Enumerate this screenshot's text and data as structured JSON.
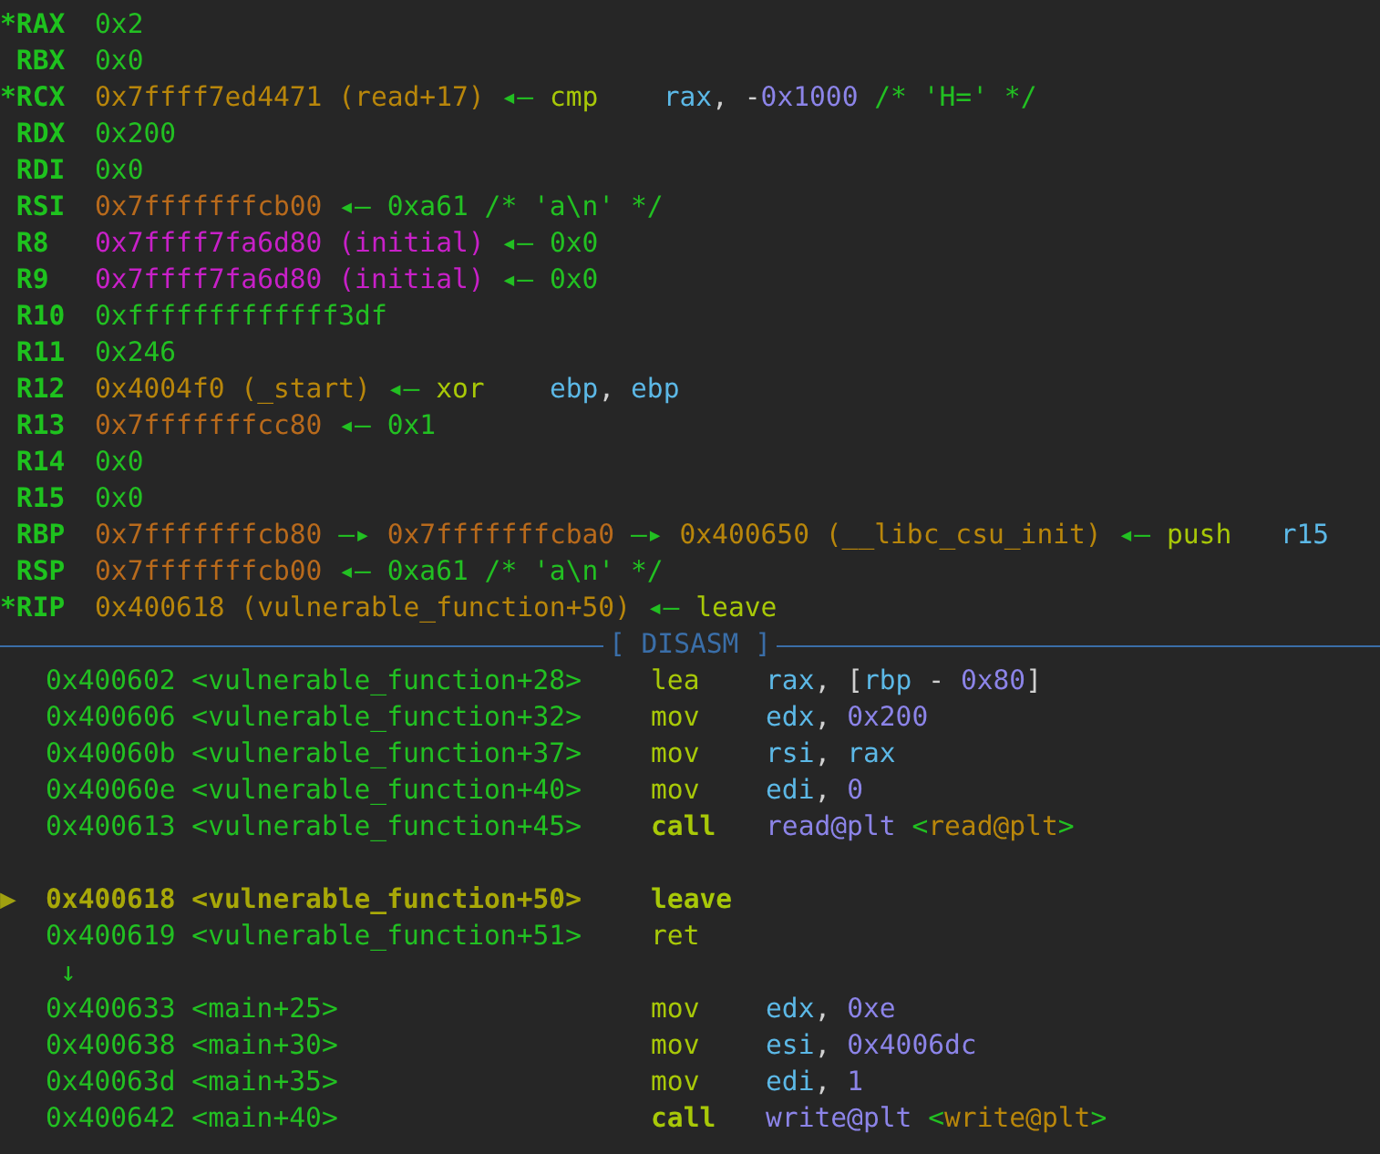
{
  "registers": [
    {
      "marker": "*",
      "name": "RAX",
      "segments": [
        {
          "text": "0x2",
          "kind": "value"
        }
      ]
    },
    {
      "name": "RBX",
      "segments": [
        {
          "text": "0x0",
          "kind": "value"
        }
      ]
    },
    {
      "marker": "*",
      "name": "RCX",
      "segments": [
        {
          "text": "0x7ffff7ed4471 (read+17)",
          "kind": "code"
        },
        {
          "text": " ◂— ",
          "kind": "arrow"
        },
        {
          "text": "cmp    ",
          "kind": "mnemonic"
        },
        {
          "text": "rax",
          "kind": "operand"
        },
        {
          "text": ", -",
          "kind": "punct"
        },
        {
          "text": "0x1000",
          "kind": "immediate"
        },
        {
          "text": " /* 'H=' */",
          "kind": "comment"
        }
      ]
    },
    {
      "name": "RDX",
      "segments": [
        {
          "text": "0x200",
          "kind": "value"
        }
      ]
    },
    {
      "name": "RDI",
      "segments": [
        {
          "text": "0x0",
          "kind": "value"
        }
      ]
    },
    {
      "name": "RSI",
      "segments": [
        {
          "text": "0x7fffffffcb00",
          "kind": "stack"
        },
        {
          "text": " ◂— 0xa61 /* 'a\\n' */",
          "kind": "value"
        }
      ]
    },
    {
      "name": "R8",
      "segments": [
        {
          "text": "0x7ffff7fa6d80 (initial)",
          "kind": "data"
        },
        {
          "text": " ◂— 0x0",
          "kind": "value"
        }
      ]
    },
    {
      "name": "R9",
      "segments": [
        {
          "text": "0x7ffff7fa6d80 (initial)",
          "kind": "data"
        },
        {
          "text": " ◂— 0x0",
          "kind": "value"
        }
      ]
    },
    {
      "name": "R10",
      "segments": [
        {
          "text": "0xfffffffffffff3df",
          "kind": "value"
        }
      ]
    },
    {
      "name": "R11",
      "segments": [
        {
          "text": "0x246",
          "kind": "value"
        }
      ]
    },
    {
      "name": "R12",
      "segments": [
        {
          "text": "0x4004f0 (_start)",
          "kind": "code"
        },
        {
          "text": " ◂— ",
          "kind": "arrow"
        },
        {
          "text": "xor    ",
          "kind": "mnemonic"
        },
        {
          "text": "ebp",
          "kind": "operand"
        },
        {
          "text": ", ",
          "kind": "punct"
        },
        {
          "text": "ebp",
          "kind": "operand"
        }
      ]
    },
    {
      "name": "R13",
      "segments": [
        {
          "text": "0x7fffffffcc80",
          "kind": "stack"
        },
        {
          "text": " ◂— 0x1",
          "kind": "value"
        }
      ]
    },
    {
      "name": "R14",
      "segments": [
        {
          "text": "0x0",
          "kind": "value"
        }
      ]
    },
    {
      "name": "R15",
      "segments": [
        {
          "text": "0x0",
          "kind": "value"
        }
      ]
    },
    {
      "name": "RBP",
      "segments": [
        {
          "text": "0x7fffffffcb80",
          "kind": "stack"
        },
        {
          "text": " —▸ ",
          "kind": "arrow"
        },
        {
          "text": "0x7fffffffcba0",
          "kind": "stack"
        },
        {
          "text": " —▸ ",
          "kind": "arrow"
        },
        {
          "text": "0x400650 (__libc_csu_init)",
          "kind": "code"
        },
        {
          "text": " ◂— ",
          "kind": "arrow"
        },
        {
          "text": "push   ",
          "kind": "mnemonic"
        },
        {
          "text": "r15",
          "kind": "operand"
        }
      ]
    },
    {
      "name": "RSP",
      "segments": [
        {
          "text": "0x7fffffffcb00",
          "kind": "stack"
        },
        {
          "text": " ◂— 0xa61 /* 'a\\n' */",
          "kind": "value"
        }
      ]
    },
    {
      "marker": "*",
      "name": "RIP",
      "segments": [
        {
          "text": "0x400618 (vulnerable_function+50)",
          "kind": "code"
        },
        {
          "text": " ◂— ",
          "kind": "arrow"
        },
        {
          "text": "leave",
          "kind": "mnemonic"
        }
      ]
    }
  ],
  "disasm": {
    "title": "[ DISASM ]",
    "lines": [
      {
        "kind": "instruction",
        "current": false,
        "address": "0x400602",
        "symbol": "<vulnerable_function+28>",
        "mnemonic": "lea",
        "operands": [
          {
            "text": "rax",
            "kind": "operand"
          },
          {
            "text": ", [",
            "kind": "punct"
          },
          {
            "text": "rbp",
            "kind": "operand"
          },
          {
            "text": " - ",
            "kind": "punct"
          },
          {
            "text": "0x80",
            "kind": "immediate"
          },
          {
            "text": "]",
            "kind": "punct"
          }
        ]
      },
      {
        "kind": "instruction",
        "current": false,
        "address": "0x400606",
        "symbol": "<vulnerable_function+32>",
        "mnemonic": "mov",
        "operands": [
          {
            "text": "edx",
            "kind": "operand"
          },
          {
            "text": ", ",
            "kind": "punct"
          },
          {
            "text": "0x200",
            "kind": "immediate"
          }
        ]
      },
      {
        "kind": "instruction",
        "current": false,
        "address": "0x40060b",
        "symbol": "<vulnerable_function+37>",
        "mnemonic": "mov",
        "operands": [
          {
            "text": "rsi",
            "kind": "operand"
          },
          {
            "text": ", ",
            "kind": "punct"
          },
          {
            "text": "rax",
            "kind": "operand"
          }
        ]
      },
      {
        "kind": "instruction",
        "current": false,
        "address": "0x40060e",
        "symbol": "<vulnerable_function+40>",
        "mnemonic": "mov",
        "operands": [
          {
            "text": "edi",
            "kind": "operand"
          },
          {
            "text": ", ",
            "kind": "punct"
          },
          {
            "text": "0",
            "kind": "immediate"
          }
        ]
      },
      {
        "kind": "instruction",
        "current": false,
        "call": true,
        "address": "0x400613",
        "symbol": "<vulnerable_function+45>",
        "mnemonic": "call",
        "operands": [
          {
            "text": "read@plt",
            "kind": "immediate"
          },
          {
            "text": " <",
            "kind": "value"
          },
          {
            "text": "read@plt",
            "kind": "code"
          },
          {
            "text": ">",
            "kind": "value"
          }
        ]
      },
      {
        "kind": "blank"
      },
      {
        "kind": "instruction",
        "current": true,
        "marker": "▶",
        "address": "0x400618",
        "symbol": "<vulnerable_function+50>",
        "mnemonic": "leave"
      },
      {
        "kind": "instruction",
        "current": false,
        "address": "0x400619",
        "symbol": "<vulnerable_function+51>",
        "mnemonic": "ret"
      },
      {
        "kind": "jump",
        "text": "↓"
      },
      {
        "kind": "instruction",
        "current": false,
        "address": "0x400633",
        "symbol": "<main+25>",
        "mnemonic": "mov",
        "operands": [
          {
            "text": "edx",
            "kind": "operand"
          },
          {
            "text": ", ",
            "kind": "punct"
          },
          {
            "text": "0xe",
            "kind": "immediate"
          }
        ]
      },
      {
        "kind": "instruction",
        "current": false,
        "address": "0x400638",
        "symbol": "<main+30>",
        "mnemonic": "mov",
        "operands": [
          {
            "text": "esi",
            "kind": "operand"
          },
          {
            "text": ", ",
            "kind": "punct"
          },
          {
            "text": "0x4006dc",
            "kind": "immediate"
          }
        ]
      },
      {
        "kind": "instruction",
        "current": false,
        "address": "0x40063d",
        "symbol": "<main+35>",
        "mnemonic": "mov",
        "operands": [
          {
            "text": "edi",
            "kind": "operand"
          },
          {
            "text": ", ",
            "kind": "punct"
          },
          {
            "text": "1",
            "kind": "immediate"
          }
        ]
      },
      {
        "kind": "instruction",
        "current": false,
        "call": true,
        "address": "0x400642",
        "symbol": "<main+40>",
        "mnemonic": "call",
        "operands": [
          {
            "text": "write@plt",
            "kind": "immediate"
          },
          {
            "text": " <",
            "kind": "value"
          },
          {
            "text": "write@plt",
            "kind": "code"
          },
          {
            "text": ">",
            "kind": "value"
          }
        ]
      }
    ]
  }
}
